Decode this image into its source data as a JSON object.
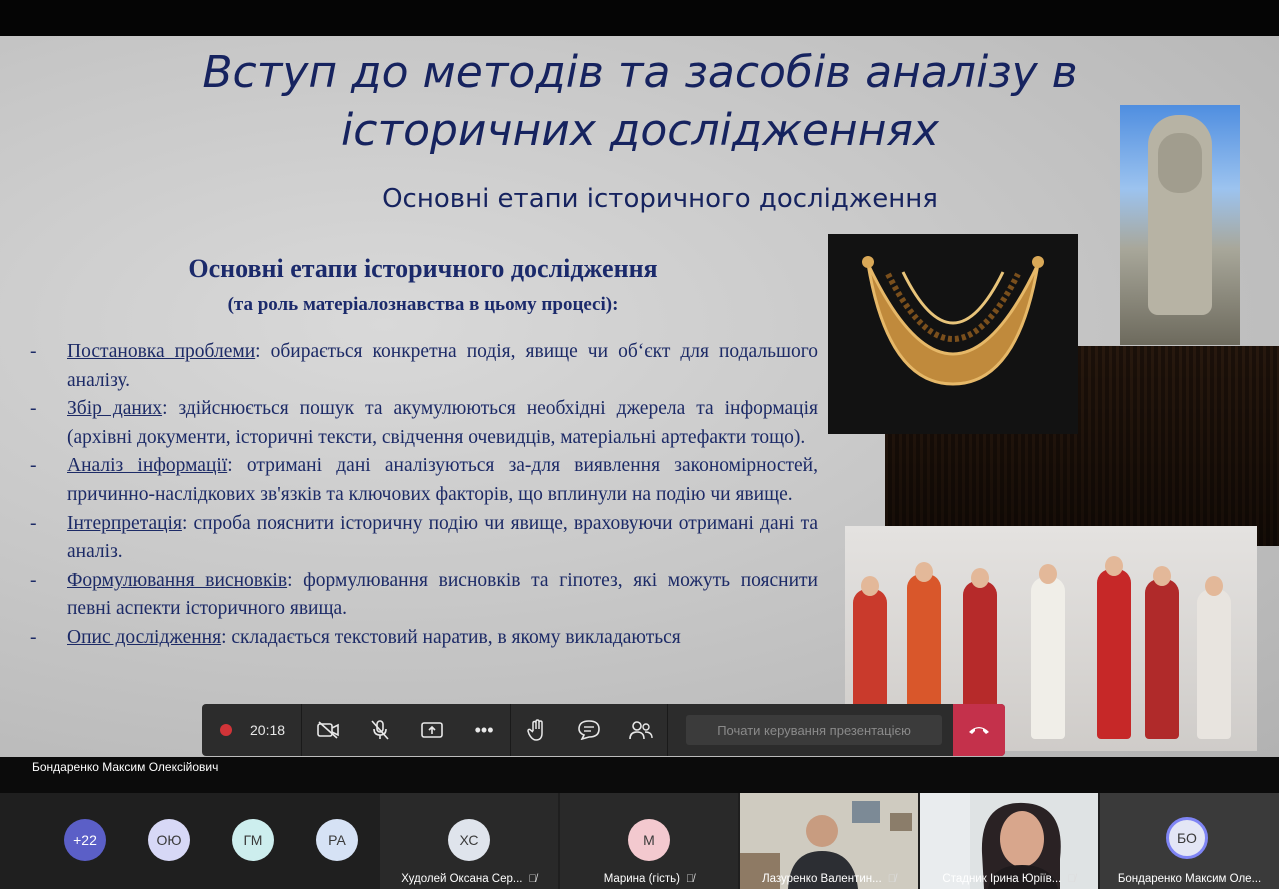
{
  "slide": {
    "title_line1": "Вступ до методів та засобів аналізу в",
    "title_line2": "історичних дослідженнях",
    "subtitle": "Основні етапи історичного дослідження",
    "heading": "Основні етапи історичного дослідження",
    "subheading": "(та роль матеріалознавства в цьому процесі):",
    "bullets": [
      {
        "term": "Постановка проблеми",
        "text": ": обирається конкретна подія, явище чи об‘єкт для подальшого аналізу."
      },
      {
        "term": "Збір даних",
        "text": ": здійснюється пошук та акумулюються необхідні джерела та інформація (архівні документи, історичні тексти, свідчення очевидців, матеріальні артефакти тощо)."
      },
      {
        "term": "Аналіз інформації",
        "text": ": отримані дані аналізуються за-для виявлення закономірностей, причинно-наслідкових зв'язків та ключових факторів, що вплинули на подію чи явище."
      },
      {
        "term": "Інтерпретація",
        "text": ": спроба пояснити історичну подію чи явище, враховуючи отримані дані та аналіз."
      },
      {
        "term": "Формулювання висновків",
        "text": ": формулювання висновків та гіпотез, які можуть пояснити певні аспекти історичного явища."
      },
      {
        "term": "Опис дослідження",
        "text": ": складається текстовий наратив, в якому викладаються"
      }
    ]
  },
  "toolbar": {
    "timer": "20:18",
    "present_control_label": "Почати керування презентацією"
  },
  "presenter": {
    "name": "Бондаренко Максим Олексійович"
  },
  "participants": {
    "overflow": "+22",
    "avatars": [
      "ОЮ",
      "ГМ",
      "РА"
    ],
    "tiles": [
      {
        "initials": "ХС",
        "name": "Худолей Оксана Сер..."
      },
      {
        "initials": "М",
        "name": "Марина (гість)"
      },
      {
        "name": "Лазуренко Валентин..."
      },
      {
        "name": "Стадник Ірина Юріїв..."
      },
      {
        "initials": "БО",
        "name": "Бондаренко Максим Оле..."
      }
    ]
  },
  "colors": {
    "slide_text": "#16235f",
    "hangup": "#c4314b",
    "record": "#d13438"
  }
}
